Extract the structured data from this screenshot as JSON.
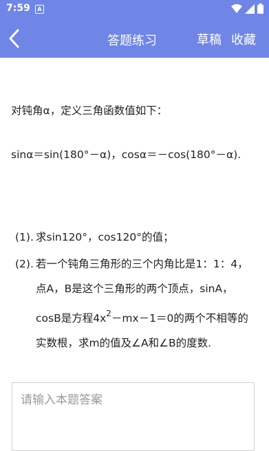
{
  "status_bar": {
    "time": "7:59",
    "notification_badge": "A"
  },
  "nav": {
    "title": "答题练习",
    "draft_label": "草稿",
    "favorite_label": "收藏",
    "bg_color": "#6f86e6"
  },
  "question": {
    "intro": "对钝角α，定义三角函数值如下：",
    "definition": "sinα＝sin(180°－α)，cosα＝－cos(180°－α).",
    "parts": [
      {
        "num": "(1).",
        "text": "求sin120°，cos120°的值；"
      },
      {
        "num": "(2).",
        "text_before_sup": "若一个钝角三角形的三个内角比是1：1：4，点A，B是这个三角形的两个顶点，sinA，cosB是方程4x",
        "sup": "2",
        "text_after_sup": "－mx－1＝0的两个不相等的实数根，求m的值及∠A和∠B的度数."
      }
    ]
  },
  "answer": {
    "placeholder": "请输入本题答案"
  }
}
